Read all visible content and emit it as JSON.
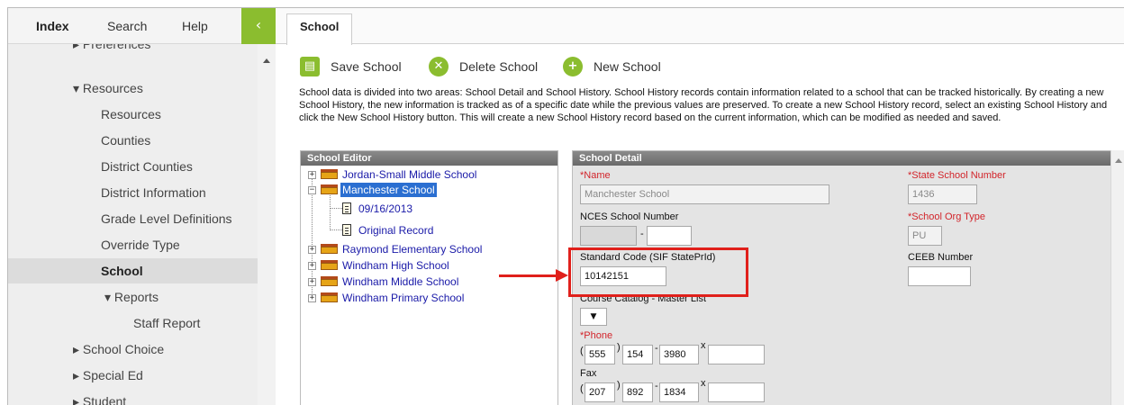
{
  "sidebar": {
    "tabs": [
      "Index",
      "Search",
      "Help"
    ],
    "collapse_icon": "chevron-left-icon",
    "items": [
      {
        "label": "▸ Preferences"
      },
      {
        "label": "▾ Resources"
      },
      {
        "label": "Resources"
      },
      {
        "label": "Counties"
      },
      {
        "label": "District Counties"
      },
      {
        "label": "District Information"
      },
      {
        "label": "Grade Level Definitions"
      },
      {
        "label": "Override Type"
      },
      {
        "label": "School"
      },
      {
        "label": "▾ Reports"
      },
      {
        "label": "Staff Report"
      },
      {
        "label": "▸ School Choice"
      },
      {
        "label": "▸ Special Ed"
      },
      {
        "label": "▸ Student"
      }
    ]
  },
  "main": {
    "tab": "School",
    "toolbar": {
      "save": "Save School",
      "delete": "Delete School",
      "new": "New School"
    },
    "info": "School data is divided into two areas: School Detail and School History. School History records contain information related to a school that can be tracked historically. By creating a new School History, the new information is tracked as of a specific date while the previous values are preserved. To create a new School History record, select an existing School History and click the New School History button. This will create a new School History record based on the current information, which can be modified as needed and saved."
  },
  "editor": {
    "title": "School Editor",
    "nodes": [
      "Jordan-Small Middle School",
      "Manchester School",
      "09/16/2013",
      "Original Record",
      "Raymond Elementary School",
      "Windham High School",
      "Windham Middle School",
      "Windham Primary School"
    ]
  },
  "detail": {
    "title": "School Detail",
    "name_label": "*Name",
    "name_value": "Manchester School",
    "state_number_label": "*State School Number",
    "state_number_value": "1436",
    "nces_label": "NCES School Number",
    "nces_sep": "-",
    "org_type_label": "*School Org Type",
    "org_type_value": "PU",
    "standard_code_label": "Standard Code (SIF StatePrId)",
    "standard_code_value": "10142151",
    "ceeb_label": "CEEB Number",
    "catalog_label": "Course Catalog - Master List",
    "catalog_icon": "▼",
    "phone_label": "*Phone",
    "phone": {
      "area": "555",
      "prefix": "154",
      "line": "3980",
      "ext_mark": "x"
    },
    "fax_label": "Fax",
    "fax": {
      "area": "207",
      "prefix": "892",
      "line": "1834",
      "ext_mark": "x"
    },
    "paren_open": "(",
    "paren_close": ")",
    "dash": "-"
  },
  "colors": {
    "accent_green": "#8bbd2f",
    "highlight_red": "#e0201b",
    "required_red": "#d2242a",
    "link_blue": "#1a1aa8"
  }
}
